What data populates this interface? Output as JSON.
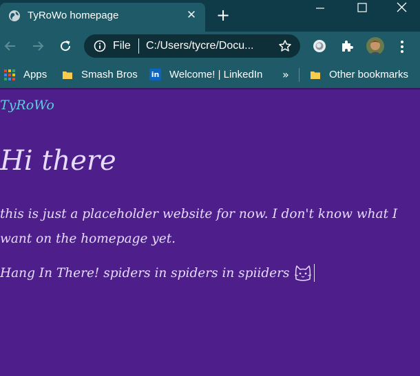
{
  "browser": {
    "tab": {
      "title": "TyRoWo homepage",
      "close_glyph": "✕",
      "favicon": "globe-icon"
    },
    "new_tab_glyph": "+",
    "window_controls": [
      "minimize-icon",
      "maximize-icon",
      "close-icon"
    ],
    "omnibox": {
      "scheme_label": "File",
      "url": "C:/Users/tycre/Docu..."
    },
    "bookmarks": {
      "apps": "Apps",
      "items": [
        {
          "label": "Smash Bros",
          "icon": "folder-icon"
        },
        {
          "label": "Welcome! | LinkedIn",
          "icon": "linkedin-icon",
          "icon_text": "in"
        }
      ],
      "more": "»",
      "other": "Other bookmarks"
    }
  },
  "page": {
    "logo": "TyRoWo",
    "heading": "Hi there",
    "paragraph1": "this is just a placeholder website for now. I don't know what I want on the homepage yet.",
    "paragraph2": "Hang In There! spiders in spiders in spiiders"
  },
  "colors": {
    "page_background": "#4e1e8a",
    "logo_text": "#5ecfe0",
    "body_text": "#e6dcff",
    "chrome_tab": "#1f5a68",
    "titlebar": "#0f3a47"
  }
}
